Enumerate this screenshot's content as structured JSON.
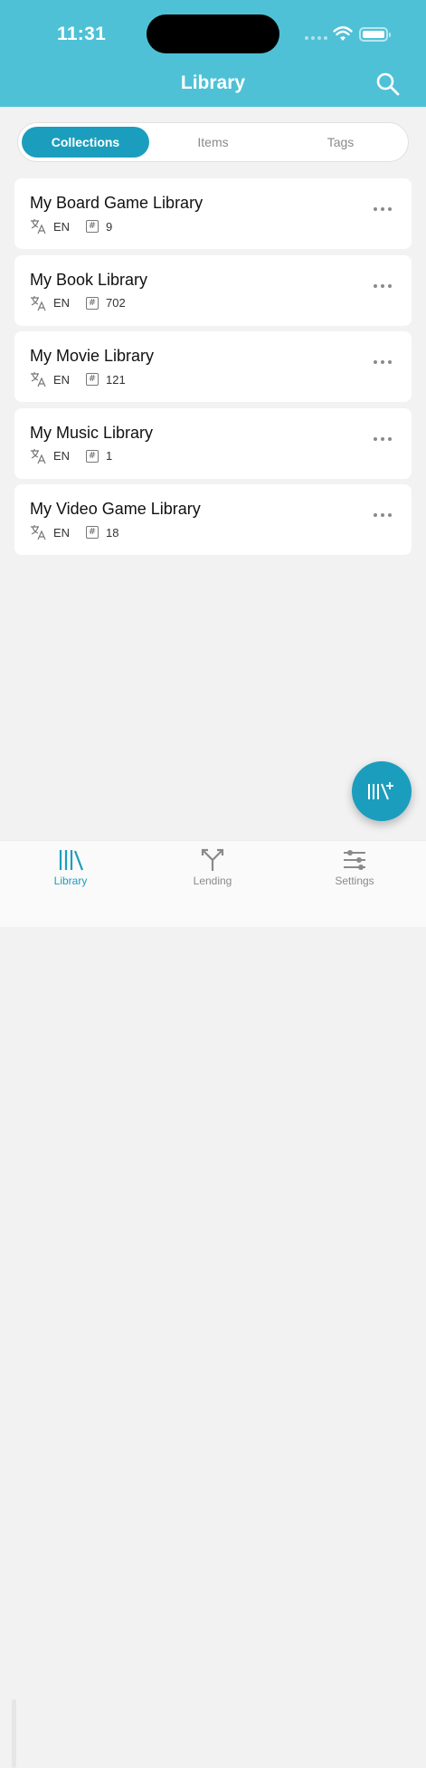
{
  "status_bar": {
    "time": "11:31"
  },
  "header": {
    "title": "Library"
  },
  "segments": [
    {
      "label": "Collections",
      "active": true
    },
    {
      "label": "Items",
      "active": false
    },
    {
      "label": "Tags",
      "active": false
    }
  ],
  "collections": [
    {
      "name": "My Board Game Library",
      "language": "EN",
      "count": "9"
    },
    {
      "name": "My Book Library",
      "language": "EN",
      "count": "702"
    },
    {
      "name": "My Movie Library",
      "language": "EN",
      "count": "121"
    },
    {
      "name": "My Music Library",
      "language": "EN",
      "count": "1"
    },
    {
      "name": "My Video Game Library",
      "language": "EN",
      "count": "18"
    }
  ],
  "tabbar": {
    "library": "Library",
    "lending": "Lending",
    "settings": "Settings"
  },
  "colors": {
    "header": "#4fc1d6",
    "accent": "#1b9ebd",
    "background": "#f2f2f2"
  },
  "icons": {
    "search": "search-icon",
    "add": "add-collection-icon",
    "more": "more-icon",
    "language": "translate-icon",
    "count": "hash-icon"
  }
}
